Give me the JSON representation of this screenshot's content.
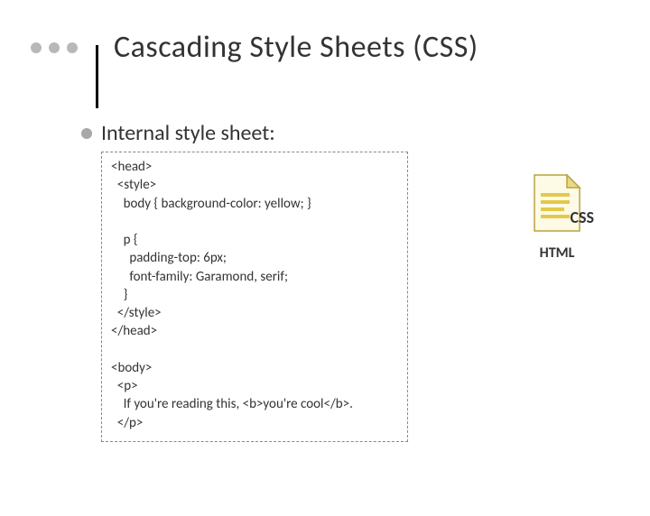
{
  "title": "Cascading Style Sheets (CSS)",
  "bullet": "Internal style sheet:",
  "code": "<head>\n  <style>\n    body { background-color: yellow; }\n\n    p {\n      padding-top: 6px;\n      font-family: Garamond, serif;\n    }\n  </style>\n</head>\n\n<body>\n  <p>\n    If you're reading this, <b>you're cool</b>.\n  </p>",
  "icon": {
    "css_label": "CSS",
    "html_label": "HTML"
  }
}
